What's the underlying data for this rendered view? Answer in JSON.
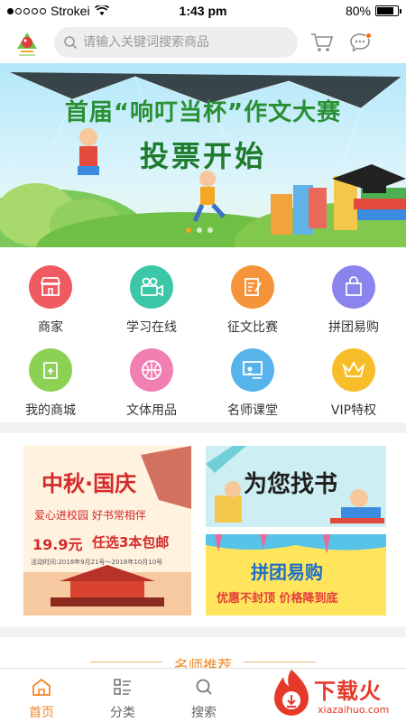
{
  "status_bar": {
    "carrier": "Strokei",
    "time": "1:43 pm",
    "battery": "80%",
    "battery_level": 0.8
  },
  "header": {
    "logo_icon": "bird-mascot-logo",
    "search_placeholder": "请输入关键词搜索商品",
    "cart_icon": "cart-icon",
    "message_icon": "chat-bubble-icon"
  },
  "banner": {
    "title": "首届“响叮当杯”作文大赛",
    "subtitle": "投票开始",
    "slide_count": 3,
    "active_slide": 1
  },
  "categories": [
    {
      "label": "商家",
      "icon": "shop-icon",
      "color": "#ef5b61"
    },
    {
      "label": "学习在线",
      "icon": "video-camera-icon",
      "color": "#3cc8a8"
    },
    {
      "label": "征文比赛",
      "icon": "document-pen-icon",
      "color": "#f5943a"
    },
    {
      "label": "拼团易购",
      "icon": "shopping-bag-icon",
      "color": "#8c84ee"
    },
    {
      "label": "我的商城",
      "icon": "store-door-icon",
      "color": "#8cd154"
    },
    {
      "label": "文体用品",
      "icon": "basketball-icon",
      "color": "#f17fb2"
    },
    {
      "label": "名师课堂",
      "icon": "teacher-board-icon",
      "color": "#56b4ea"
    },
    {
      "label": "VIP特权",
      "icon": "crown-icon",
      "color": "#f7be2a"
    }
  ],
  "promos": {
    "left": {
      "title": "中秋·国庆",
      "line1": "爱心进校园 好书常相伴",
      "price": "19.9元",
      "offer": "任选3本包邮",
      "period": "活动时间:2018年9月21号～2018年10月10号"
    },
    "right_top": {
      "title": "为您找书"
    },
    "right_bottom": {
      "title": "拼团易购",
      "slogan": "优惠不封顶 价格降到底"
    }
  },
  "teacher_section": {
    "title": "名师推荐"
  },
  "tabbar": {
    "tabs": [
      {
        "label": "首页",
        "icon": "home-icon"
      },
      {
        "label": "分类",
        "icon": "category-list-icon"
      },
      {
        "label": "搜索",
        "icon": "search-icon"
      }
    ],
    "active_tab": 0
  },
  "watermark": {
    "brand": "下载火",
    "url": "xiazaihuo.com"
  },
  "colors": {
    "accent": "#f0862a",
    "banner_green": "#2a8f33"
  }
}
